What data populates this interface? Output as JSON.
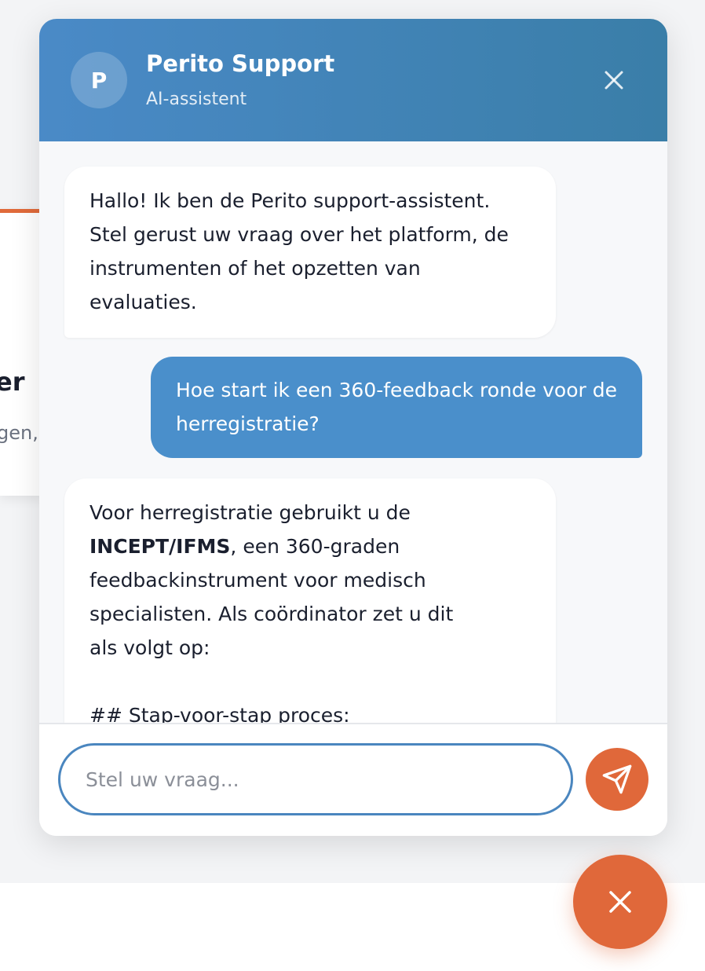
{
  "background": {
    "card_title": "er",
    "card_subtitle": "gen,"
  },
  "chat": {
    "avatar_letter": "P",
    "title": "Perito Support",
    "subtitle": "AI-assistent",
    "close_icon": "close-icon",
    "messages": [
      {
        "role": "assistant",
        "text": "Hallo! Ik ben de Perito support-assistent. Stel gerust uw vraag over het platform, de instrumenten of het opzetten van evaluaties."
      },
      {
        "role": "user",
        "text": "Hoe start ik een 360-feedback ronde voor de herregistratie?"
      },
      {
        "role": "assistant",
        "line1": "Voor herregistratie gebruikt u de",
        "bold": "INCEPT/IFMS",
        "line2_rest": ", een 360-graden",
        "line3": "feedbackinstrument voor medisch",
        "line4": "specialisten. Als coördinator zet u dit",
        "line5": "als volgt op:",
        "line6": "## Stap-voor-stap proces:"
      }
    ],
    "input": {
      "placeholder": "Stel uw vraag...",
      "value": ""
    },
    "send_icon": "send-icon"
  },
  "fab": {
    "icon": "close-icon"
  },
  "colors": {
    "header_start": "#4a8ac7",
    "header_end": "#3a7ea8",
    "user_bubble": "#4a8fcb",
    "accent_orange": "#e0683a",
    "input_border": "#4a86bf"
  }
}
